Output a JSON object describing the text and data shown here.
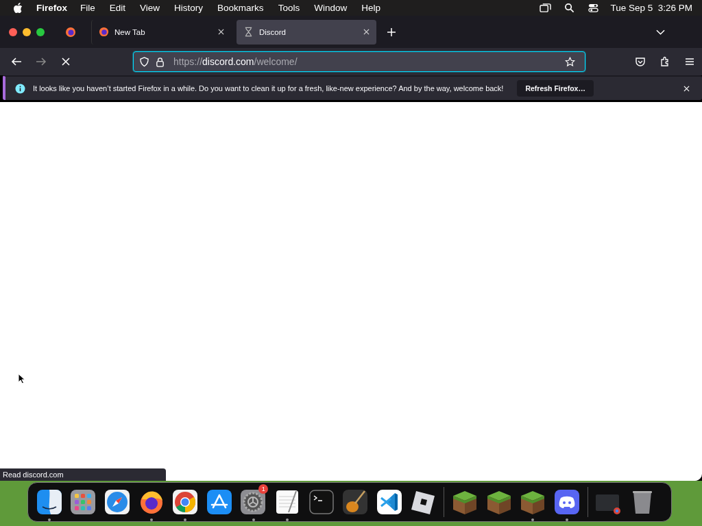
{
  "menu_bar": {
    "app": "Firefox",
    "items": [
      "File",
      "Edit",
      "View",
      "History",
      "Bookmarks",
      "Tools",
      "Window",
      "Help"
    ],
    "clock": "Tue Sep 5  3:26 PM"
  },
  "tabs": [
    {
      "title": "New Tab",
      "selected": false,
      "kind": "firefox"
    },
    {
      "title": "Discord",
      "selected": true,
      "kind": "hourglass"
    }
  ],
  "address": {
    "scheme": "https://",
    "domain": "discord.com",
    "path": "/welcome/"
  },
  "notification": {
    "message": "It looks like you haven’t started Firefox in a while. Do you want to clean it up for a fresh, like-new experience? And by the way, welcome back!",
    "button": "Refresh Firefox…"
  },
  "status": "Read discord.com",
  "dock": [
    {
      "kind": "finder",
      "running": true
    },
    {
      "kind": "launchpad",
      "running": false
    },
    {
      "kind": "safari",
      "running": false
    },
    {
      "kind": "firefox",
      "running": true
    },
    {
      "kind": "chrome",
      "running": true
    },
    {
      "kind": "appstore",
      "running": false
    },
    {
      "kind": "settings",
      "running": true,
      "badge": "1"
    },
    {
      "kind": "textedit",
      "running": true
    },
    {
      "kind": "terminal",
      "running": false
    },
    {
      "kind": "guitar",
      "running": false
    },
    {
      "kind": "vscode",
      "running": false
    },
    {
      "kind": "roblox",
      "running": false
    },
    {
      "kind": "separator"
    },
    {
      "kind": "block",
      "running": false
    },
    {
      "kind": "block",
      "running": false
    },
    {
      "kind": "block",
      "running": true
    },
    {
      "kind": "discord",
      "running": true
    },
    {
      "kind": "separator"
    },
    {
      "kind": "window",
      "running": false
    },
    {
      "kind": "trash",
      "running": false
    }
  ]
}
